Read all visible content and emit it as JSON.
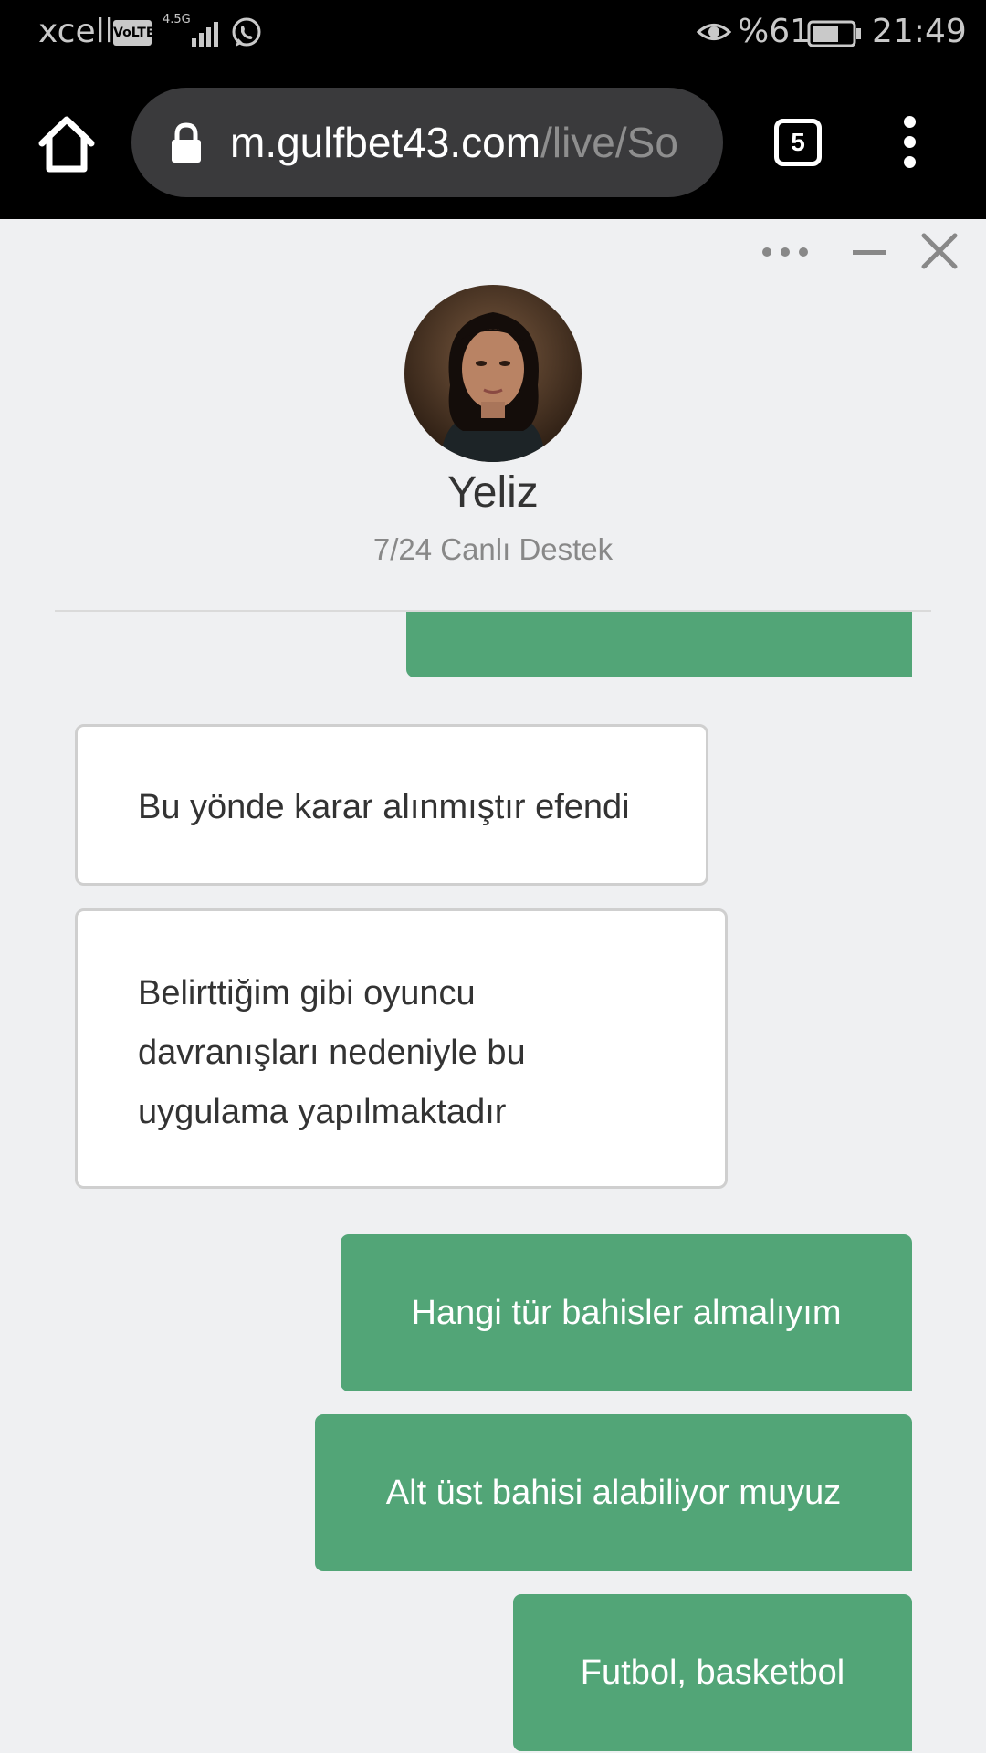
{
  "status_bar": {
    "carrier": "xcell",
    "volte": "VoLTE",
    "network": "4.5G",
    "battery_percent": "%61",
    "time": "21:49",
    "icons": [
      "signal-icon",
      "whatsapp-icon",
      "eye-icon",
      "battery-icon"
    ]
  },
  "browser": {
    "url_host": "m.gulfbet43.com",
    "url_path": "/live/So",
    "tab_count": "5",
    "icons": [
      "home-icon",
      "lock-icon",
      "overflow-menu-icon"
    ]
  },
  "chat": {
    "agent_name": "Yeliz",
    "agent_role": "7/24 Canlı Destek",
    "controls": [
      "more-icon",
      "minimize-icon",
      "close-icon"
    ],
    "messages": [
      {
        "from": "user",
        "text": ""
      },
      {
        "from": "agent",
        "text": "Bu yönde karar alınmıştır efendi"
      },
      {
        "from": "agent",
        "text": "Belirttiğim gibi oyuncu davranışları nedeniyle bu uygulama yapılmaktadır"
      },
      {
        "from": "user",
        "text": "Hangi tür bahisler almalıyım"
      },
      {
        "from": "user",
        "text": "Alt üst bahisi alabiliyor muyuz"
      },
      {
        "from": "user",
        "text": "Futbol, basketbol"
      }
    ],
    "colors": {
      "outgoing_bubble": "#52a577",
      "incoming_bubble": "#ffffff",
      "background": "#eff0f2"
    }
  }
}
